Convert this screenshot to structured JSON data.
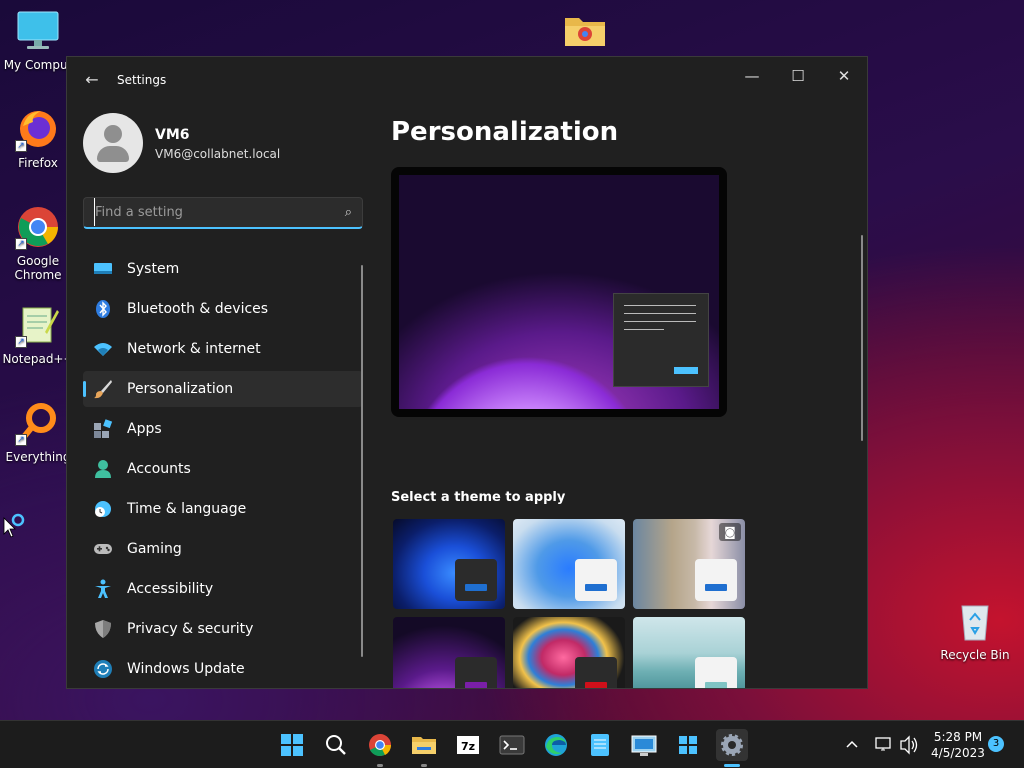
{
  "desktop": {
    "icons": [
      {
        "label": "My Comput"
      },
      {
        "label": "Firefox"
      },
      {
        "label": "Google Chrome"
      },
      {
        "label": "Notepad++"
      },
      {
        "label": "Everything"
      },
      {
        "label": "Recycle Bin"
      }
    ]
  },
  "window": {
    "title": "Settings",
    "minimize_icon": "minimize-icon",
    "maximize_icon": "maximize-icon",
    "close_icon": "close-icon"
  },
  "profile": {
    "name": "VM6",
    "email": "VM6@collabnet.local"
  },
  "search": {
    "placeholder": "Find a setting",
    "value": ""
  },
  "sidebar": {
    "items": [
      {
        "label": "System",
        "icon": "system-icon",
        "color": "#4cc2ff"
      },
      {
        "label": "Bluetooth & devices",
        "icon": "bluetooth-icon",
        "color": "#2f7de1"
      },
      {
        "label": "Network & internet",
        "icon": "wifi-icon",
        "color": "#4cc2ff"
      },
      {
        "label": "Personalization",
        "icon": "brush-icon",
        "color": "#e8a55a",
        "active": true
      },
      {
        "label": "Apps",
        "icon": "apps-icon",
        "color": "#9aa5b5"
      },
      {
        "label": "Accounts",
        "icon": "accounts-icon",
        "color": "#3fbf9f"
      },
      {
        "label": "Time & language",
        "icon": "globe-clock-icon",
        "color": "#4cc2ff"
      },
      {
        "label": "Gaming",
        "icon": "gamepad-icon",
        "color": "#bbbbbb"
      },
      {
        "label": "Accessibility",
        "icon": "accessibility-icon",
        "color": "#4cc2ff"
      },
      {
        "label": "Privacy & security",
        "icon": "shield-icon",
        "color": "#a8a8a8"
      },
      {
        "label": "Windows Update",
        "icon": "update-icon",
        "color": "#4cc2ff"
      }
    ]
  },
  "main": {
    "title": "Personalization",
    "themes_label": "Select a theme to apply",
    "themes": [
      {
        "name": "windows-dark",
        "accent": "#1f6fd0"
      },
      {
        "name": "windows-light",
        "accent": "#1f6fd0"
      },
      {
        "name": "windows-spotlight",
        "accent": "#1f6fd0"
      },
      {
        "name": "glow",
        "accent": "#7a1fa8"
      },
      {
        "name": "captured-motion",
        "accent": "#d0101a"
      },
      {
        "name": "flow",
        "accent": "#7fc4c4"
      }
    ]
  },
  "taskbar": {
    "apps": [
      "start-icon",
      "search-icon",
      "chrome-icon",
      "file-explorer-icon",
      "7zip-icon",
      "terminal-icon",
      "edge-icon",
      "notepad-icon",
      "remote-desktop-icon",
      "windows-icon",
      "settings-icon"
    ],
    "clock_time": "5:28 PM",
    "clock_date": "4/5/2023",
    "notification_count": "3"
  },
  "colors": {
    "accent": "#4cc2ff",
    "window_bg": "#202020"
  }
}
